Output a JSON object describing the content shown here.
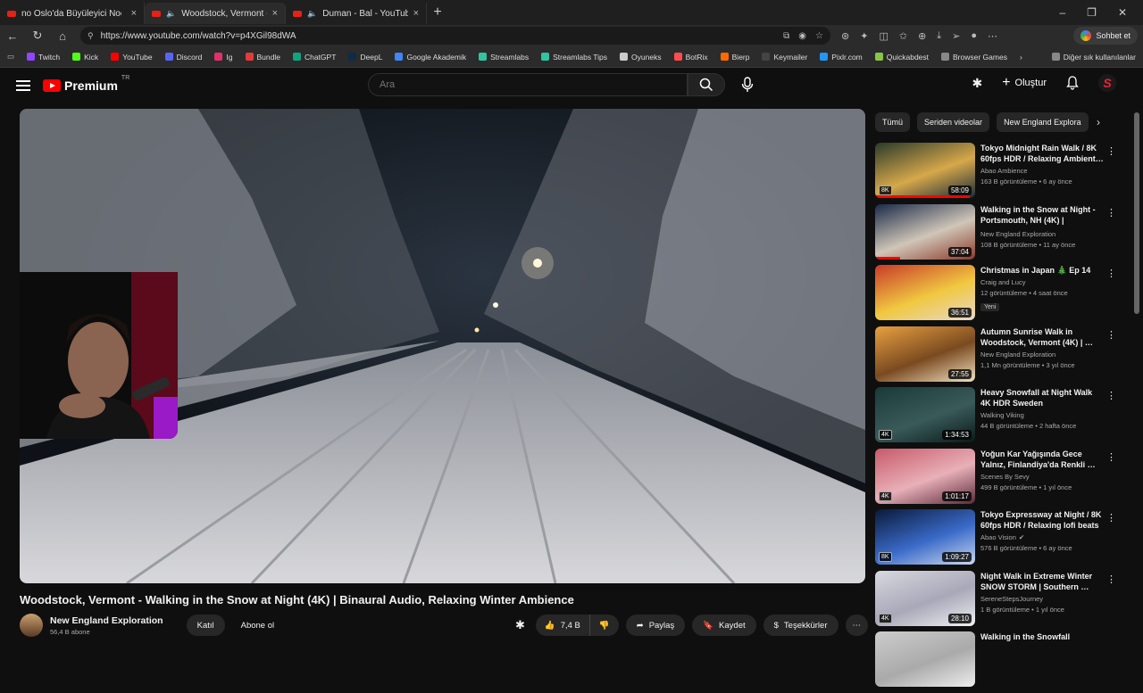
{
  "browser": {
    "tabs": [
      {
        "title": "no Oslo'da Büyüleyici Noel Turu",
        "active": false
      },
      {
        "title": "Woodstock, Vermont - Walkin",
        "active": true
      },
      {
        "title": "Duman - Bal - YouTube",
        "active": false
      }
    ],
    "url": "https://www.youtube.com/watch?v=p4XGil98dWA",
    "chat_button": "Sohbet et",
    "bookmarks": [
      "Twitch",
      "Kick",
      "YouTube",
      "Discord",
      "Ig",
      "Bundle",
      "ChatGPT",
      "DeepL",
      "Google Akademik",
      "Streamlabs",
      "Streamlabs Tips",
      "Oyuneks",
      "BotRix",
      "Bierp",
      "Keymailer",
      "Pixlr.com",
      "Quickabdest",
      "Browser Games",
      "Diğer sık kullanılanlar"
    ],
    "bookmark_colors": [
      "#9146ff",
      "#53fc18",
      "#ff0000",
      "#5865f2",
      "#e1306c",
      "#e23b3b",
      "#10a37f",
      "#0f2b46",
      "#4285f4",
      "#31c3a2",
      "#31c3a2",
      "#cccccc",
      "#ff4d4d",
      "#ff6a00",
      "#444444",
      "#2196f3",
      "#8bc34a",
      "#888888",
      "#888888"
    ]
  },
  "youtube": {
    "logo_text": "Premium",
    "region": "TR",
    "search_placeholder": "Ara",
    "create_label": "Oluştur",
    "avatar_letter": "S",
    "video_title": "Woodstock, Vermont - Walking in the Snow at Night (4K) | Binaural Audio, Relaxing Winter Ambience",
    "channel_name": "New England Exploration",
    "channel_subs": "56,4 B abone",
    "join_label": "Katıl",
    "subscribe_label": "Abone ol",
    "like_count": "7,4 B",
    "share_label": "Paylaş",
    "save_label": "Kaydet",
    "thanks_label": "Teşekkürler",
    "chips": [
      "Tümü",
      "Seriden videolar",
      "New England Explora"
    ],
    "recommendations": [
      {
        "title": "Tokyo Midnight Rain Walk / 8K 60fps HDR / Relaxing Ambient…",
        "channel": "Abao Ambience",
        "meta": "163 B görüntüleme • 6 ay önce",
        "duration": "58:09",
        "quality": "8K",
        "watched": 0.95,
        "colors": [
          "#2a3a2a",
          "#d6a84a",
          "#1a2a3a"
        ]
      },
      {
        "title": "Walking in the Snow at Night - Portsmouth, NH (4K) | Binaura…",
        "channel": "New England Exploration",
        "meta": "108 B görüntüleme • 11 ay önce",
        "duration": "37:04",
        "quality": "",
        "watched": 0.25,
        "colors": [
          "#1a2a48",
          "#d0c6b8",
          "#8a3a2a"
        ]
      },
      {
        "title": "Christmas in Japan 🎄 Ep 14",
        "channel": "Craig and Lucy",
        "meta": "12 görüntüleme • 4 saat önce",
        "badge": "Yeni",
        "duration": "36:51",
        "quality": "",
        "watched": 0,
        "colors": [
          "#c83a2a",
          "#f0c840",
          "#e8d8c8"
        ]
      },
      {
        "title": "Autumn Sunrise Walk in Woodstock, Vermont (4K) | …",
        "channel": "New England Exploration",
        "meta": "1,1 Mn görüntüleme • 3 yıl önce",
        "duration": "27:55",
        "quality": "",
        "watched": 0,
        "colors": [
          "#e8a040",
          "#7a4a20",
          "#f0e0c0"
        ]
      },
      {
        "title": "Heavy Snowfall at Night Walk 4K HDR Sweden",
        "channel": "Walking Viking",
        "meta": "44 B görüntüleme • 2 hafta önce",
        "duration": "1:34:53",
        "quality": "4K",
        "watched": 0,
        "colors": [
          "#1a3a3a",
          "#3a5a5a",
          "#0a1a1a"
        ]
      },
      {
        "title": "Yoğun Kar Yağışında Gece Yalnız, Finlandiya'da Renkli …",
        "channel": "Scenes By Sevy",
        "meta": "499 B görüntüleme • 1 yıl önce",
        "duration": "1:01:17",
        "quality": "4K",
        "watched": 0,
        "colors": [
          "#c85a6a",
          "#e8b0b8",
          "#5a2a3a"
        ]
      },
      {
        "title": "Tokyo Expressway at Night / 8K 60fps HDR / Relaxing lofi beats",
        "channel": "Abao Vision",
        "verified": "✔",
        "meta": "576 B görüntüleme • 6 ay önce",
        "duration": "1:09:27",
        "quality": "8K",
        "watched": 0,
        "colors": [
          "#0a1a3a",
          "#3a6ac8",
          "#c8d8f0"
        ]
      },
      {
        "title": "Night Walk in Extreme Winter SNOW STORM | Southern …",
        "channel": "SereneStepsJourney",
        "meta": "1 B görüntüleme • 1 yıl önce",
        "duration": "28:10",
        "quality": "4K",
        "watched": 0,
        "colors": [
          "#d8d8e0",
          "#a8a8b8",
          "#f0f0f4"
        ]
      },
      {
        "title": "Walking in the Snowfall",
        "channel": "",
        "meta": "",
        "duration": "",
        "quality": "",
        "watched": 0,
        "colors": [
          "#cccccc",
          "#aaaaaa",
          "#eeeeee"
        ]
      }
    ]
  }
}
